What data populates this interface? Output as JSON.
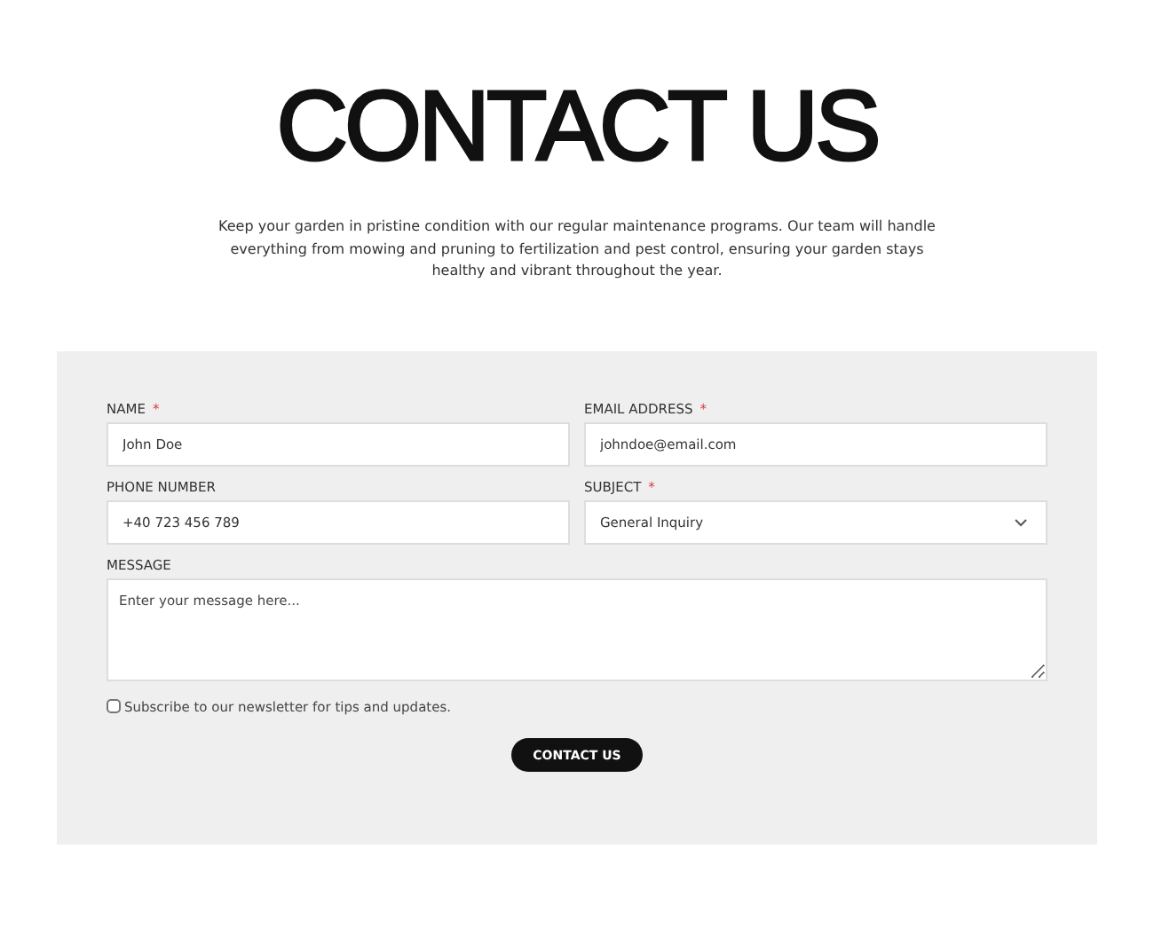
{
  "heading": "CONTACT US",
  "intro": "Keep your garden in pristine condition with our regular maintenance programs. Our team will handle everything from mowing and pruning to fertilization and pest control, ensuring your garden stays healthy and vibrant throughout the year.",
  "form": {
    "fields": [
      {
        "kind": "text",
        "label": "NAME",
        "required_mark": "*",
        "value": "John Doe"
      },
      {
        "kind": "text",
        "label": "EMAIL ADDRESS",
        "required_mark": "*",
        "value": "johndoe@email.com"
      },
      {
        "kind": "text",
        "label": "PHONE NUMBER",
        "value": "+40 723 456 789"
      },
      {
        "kind": "select",
        "label": "SUBJECT",
        "required_mark": "*",
        "value": "General Inquiry"
      },
      {
        "kind": "textarea",
        "label": "MESSAGE",
        "placeholder": "Enter your message here..."
      }
    ],
    "newsletter": {
      "label": "Subscribe to our newsletter for tips and updates.",
      "checked": false
    },
    "submit": "CONTACT US"
  }
}
